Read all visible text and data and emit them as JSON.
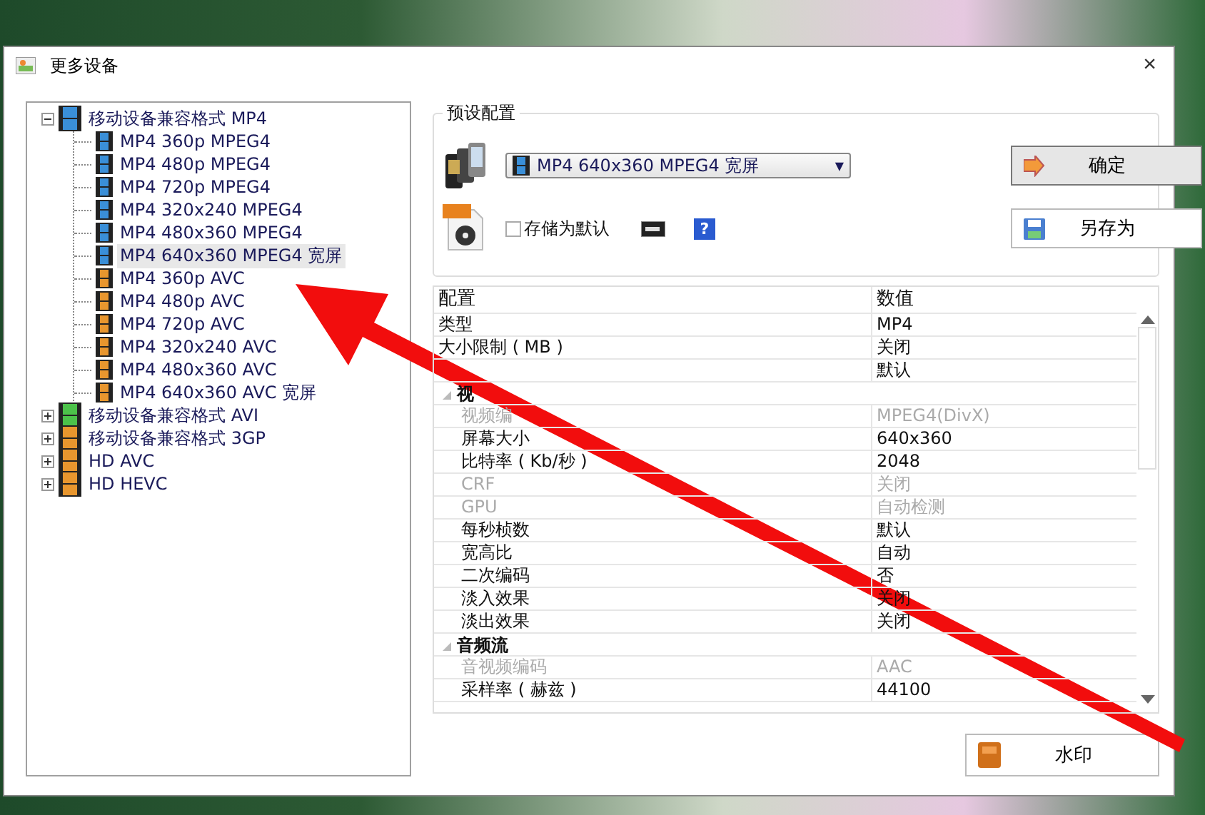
{
  "window": {
    "title": "更多设备",
    "close": "×"
  },
  "tree": [
    {
      "label": "移动设备兼容格式 MP4",
      "color": "#3a8fd8",
      "expanded": true,
      "selected": false,
      "children": [
        {
          "label": "MP4 360p MPEG4",
          "color": "#3a8fd8",
          "selected": false
        },
        {
          "label": "MP4 480p MPEG4",
          "color": "#3a8fd8",
          "selected": false
        },
        {
          "label": "MP4 720p MPEG4",
          "color": "#3a8fd8",
          "selected": false
        },
        {
          "label": "MP4 320x240 MPEG4",
          "color": "#3a8fd8",
          "selected": false
        },
        {
          "label": "MP4 480x360 MPEG4",
          "color": "#3a8fd8",
          "selected": false
        },
        {
          "label": "MP4 640x360 MPEG4 宽屏",
          "color": "#3a8fd8",
          "selected": true
        },
        {
          "label": "MP4 360p AVC",
          "color": "#e8962e",
          "selected": false
        },
        {
          "label": "MP4 480p AVC",
          "color": "#e8962e",
          "selected": false
        },
        {
          "label": "MP4 720p AVC",
          "color": "#e8962e",
          "selected": false
        },
        {
          "label": "MP4 320x240 AVC",
          "color": "#e8962e",
          "selected": false
        },
        {
          "label": "MP4 480x360 AVC",
          "color": "#e8962e",
          "selected": false
        },
        {
          "label": "MP4 640x360 AVC 宽屏",
          "color": "#e8962e",
          "selected": false
        }
      ]
    },
    {
      "label": "移动设备兼容格式 AVI",
      "color": "#4cc24a",
      "expanded": false,
      "selected": false
    },
    {
      "label": "移动设备兼容格式 3GP",
      "color": "#e8962e",
      "expanded": false,
      "selected": false
    },
    {
      "label": "HD AVC",
      "color": "#e8962e",
      "expanded": false,
      "selected": false
    },
    {
      "label": "HD HEVC",
      "color": "#e8962e",
      "expanded": false,
      "selected": false
    }
  ],
  "preset": {
    "title": "预设配置",
    "dropdown": {
      "value": "MP4 640x360 MPEG4 宽屏",
      "caret": "▼"
    },
    "save_default": {
      "label": "存储为默认",
      "checked": false
    },
    "help": "?",
    "ok_button": "确定",
    "save_as_button": "另存为"
  },
  "grid": {
    "columns": [
      "配置",
      "数值"
    ],
    "rows": [
      {
        "kind": "row",
        "name": "类型",
        "value": "MP4",
        "disabled": false
      },
      {
        "kind": "row",
        "name": "大小限制 ( MB )",
        "value": "关闭",
        "disabled": false
      },
      {
        "kind": "row",
        "value": "默认",
        "disabled": false
      },
      {
        "kind": "group",
        "name": "视",
        "expanded": true
      },
      {
        "kind": "sub",
        "name": "视频编",
        "value": "MPEG4(DivX)",
        "disabled": true
      },
      {
        "kind": "sub",
        "name": "屏幕大小",
        "value": "640x360",
        "disabled": false
      },
      {
        "kind": "sub",
        "name": "比特率 ( Kb/秒 )",
        "value": "2048",
        "disabled": false
      },
      {
        "kind": "sub",
        "name": "CRF",
        "value": "关闭",
        "disabled": true
      },
      {
        "kind": "sub",
        "name": "GPU",
        "value": "自动检测",
        "disabled": true
      },
      {
        "kind": "sub",
        "name": "每秒桢数",
        "value": "默认",
        "disabled": false
      },
      {
        "kind": "sub",
        "name": "宽高比",
        "value": "自动",
        "disabled": false
      },
      {
        "kind": "sub",
        "name": "二次编码",
        "value": "否",
        "disabled": false
      },
      {
        "kind": "sub",
        "name": "淡入效果",
        "value": "关闭",
        "disabled": false
      },
      {
        "kind": "sub",
        "name": "淡出效果",
        "value": "关闭",
        "disabled": false
      },
      {
        "kind": "group",
        "name": "音频流",
        "expanded": true
      },
      {
        "kind": "sub",
        "name": "音视频编码",
        "value": "AAC",
        "disabled": true
      },
      {
        "kind": "sub",
        "name": "采样率 ( 赫兹 )",
        "value": "44100",
        "disabled": false
      }
    ]
  },
  "watermark_button": "水印"
}
